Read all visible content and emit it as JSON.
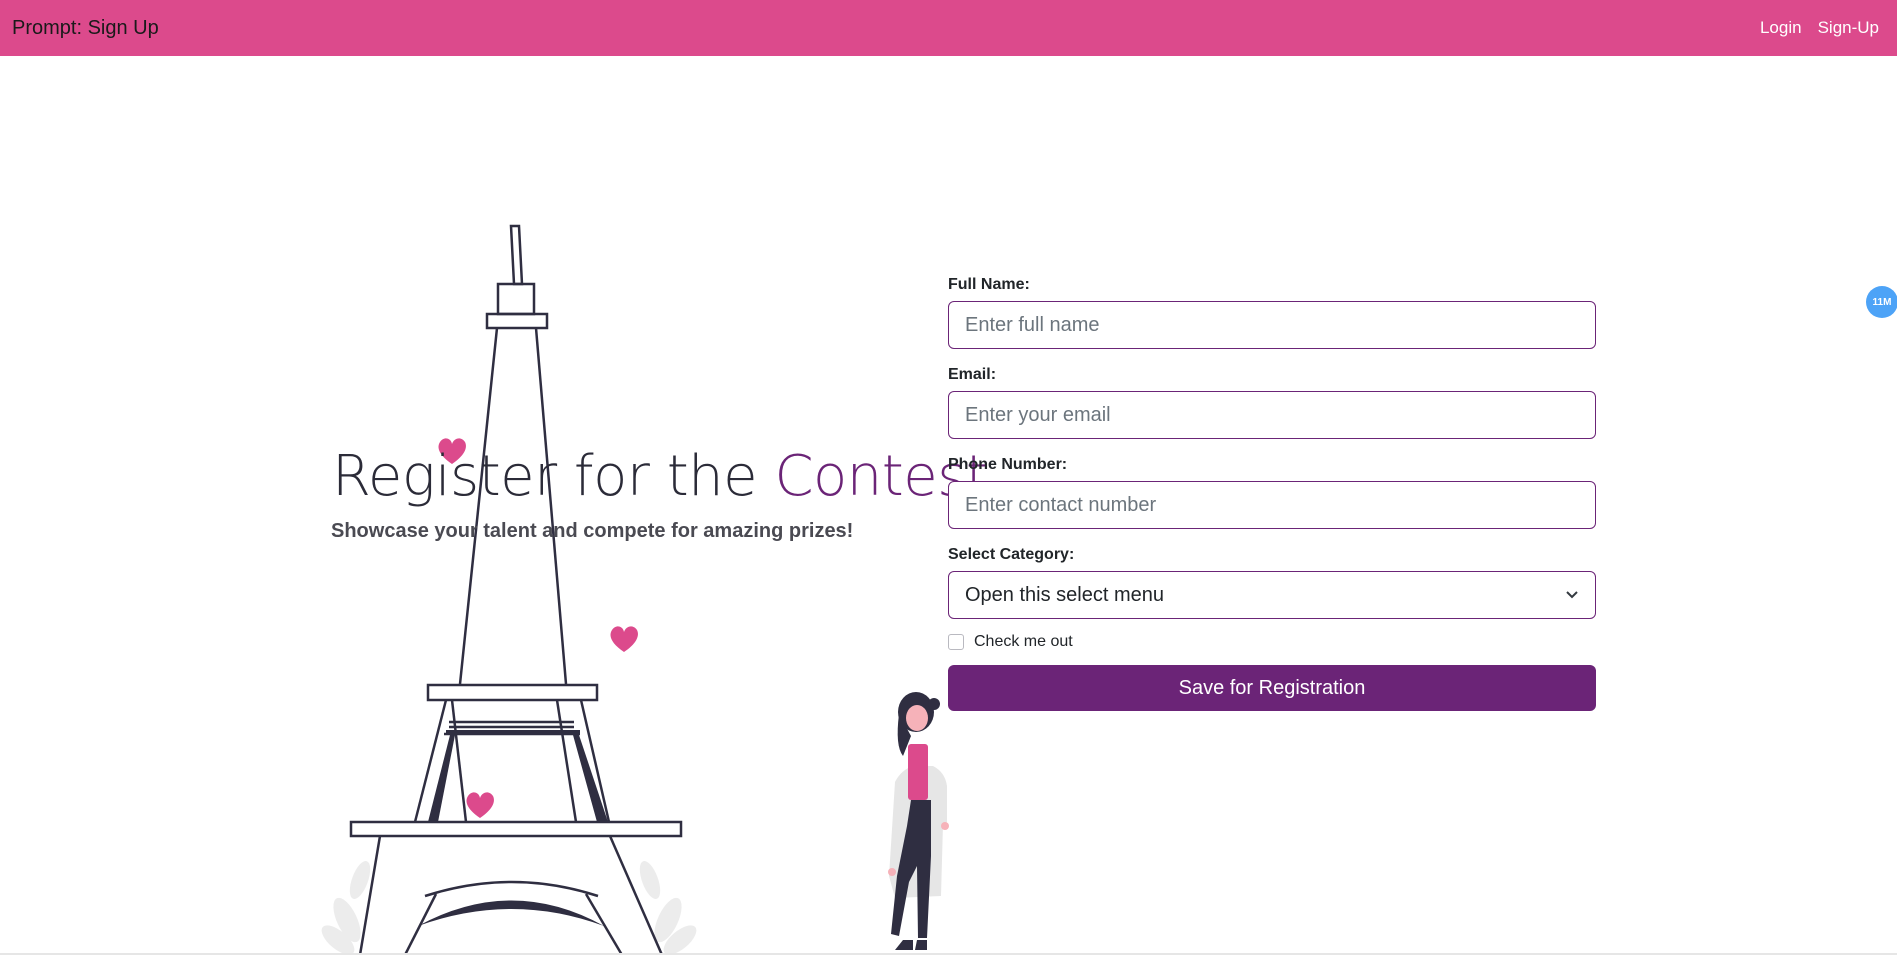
{
  "nav": {
    "brand": "Prompt: Sign Up",
    "links": [
      "Login",
      "Sign-Up"
    ]
  },
  "hero": {
    "title_main": "Register for the ",
    "title_accent": "Contest.",
    "subtitle": "Showcase your talent and compete for amazing prizes!"
  },
  "form": {
    "full_name": {
      "label": "Full Name:",
      "placeholder": "Enter full name"
    },
    "email": {
      "label": "Email:",
      "placeholder": "Enter your email"
    },
    "phone": {
      "label": "Phone Number:",
      "placeholder": "Enter contact number"
    },
    "category": {
      "label": "Select Category:",
      "selected": "Open this select menu"
    },
    "checkbox_label": "Check me out",
    "submit_label": "Save for Registration"
  },
  "badge": {
    "text": "11M"
  },
  "colors": {
    "navbar": "#dc4a8c",
    "accent_purple": "#6b2477",
    "heart_pink": "#dc4a8c",
    "tower_stroke": "#2f2e41",
    "badge_blue": "#4da3f7"
  },
  "icons": [
    "heart-icon",
    "chevron-down-icon",
    "eiffel-tower-illustration",
    "woman-illustration"
  ]
}
